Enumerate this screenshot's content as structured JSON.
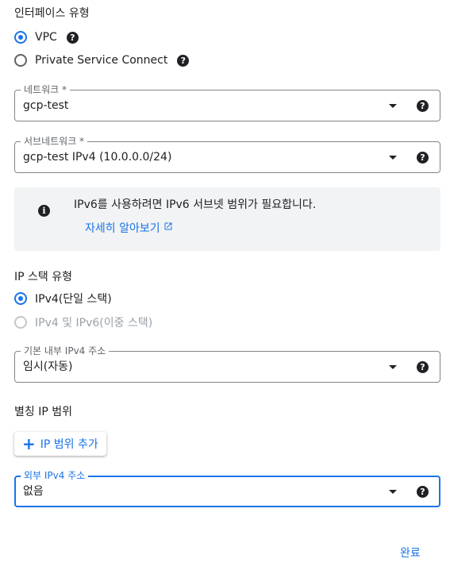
{
  "interface_type": {
    "title": "인터페이스 유형",
    "options": [
      {
        "label": "VPC",
        "selected": true
      },
      {
        "label": "Private Service Connect",
        "selected": false
      }
    ]
  },
  "network": {
    "label": "네트워크 *",
    "value": "gcp-test"
  },
  "subnetwork": {
    "label": "서브네트워크 *",
    "value": "gcp-test IPv4 (10.0.0.0/24)"
  },
  "notice": {
    "text": "IPv6를 사용하려면 IPv6 서브넷 범위가 필요합니다.",
    "link": "자세히 알아보기"
  },
  "ip_stack": {
    "title": "IP 스택 유형",
    "options": [
      {
        "label": "IPv4(단일 스택)",
        "selected": true,
        "disabled": false
      },
      {
        "label": "IPv4 및 IPv6(이중 스택)",
        "selected": false,
        "disabled": true
      }
    ]
  },
  "primary_ipv4": {
    "label": "기본 내부 IPv4 주소",
    "value": "임시(자동)"
  },
  "alias_ip": {
    "title": "별칭 IP 범위",
    "add_button": "IP 범위 추가"
  },
  "external_ipv4": {
    "label": "외부 IPv4 주소",
    "value": "없음"
  },
  "footer": {
    "done_button": "완료"
  },
  "colors": {
    "accent": "#1a73e8",
    "text": "#202124",
    "notice_bg": "#f1f3f4"
  },
  "icons": {
    "help": "help-circle-icon",
    "info": "info-circle-icon",
    "external": "open-in-new-icon",
    "dropdown": "caret-down-icon",
    "add": "plus-icon"
  }
}
